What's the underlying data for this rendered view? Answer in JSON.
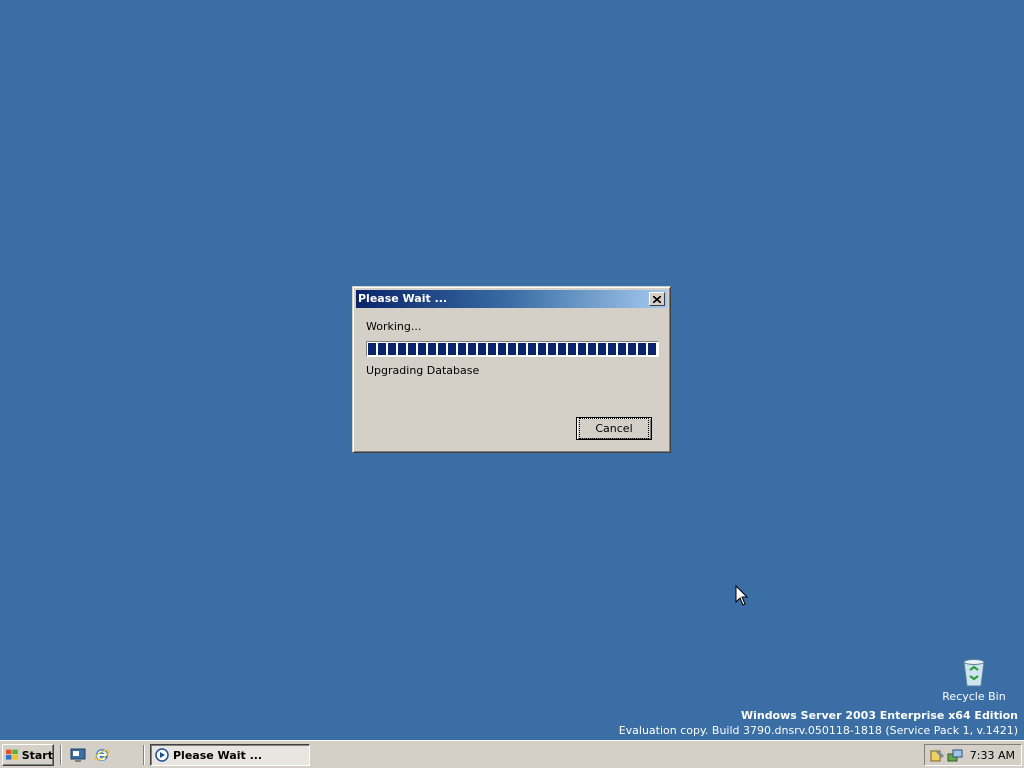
{
  "dialog": {
    "title": "Please Wait ...",
    "message": "Working...",
    "status": "Upgrading Database",
    "progress_percent": 100,
    "cancel_label": "Cancel"
  },
  "desktop": {
    "recycle_bin_label": "Recycle Bin",
    "edition": "Windows Server 2003 Enterprise x64 Edition",
    "build": "Evaluation copy. Build 3790.dnsrv.050118-1818 (Service Pack 1, v.1421)",
    "background_color": "#3a6ea5"
  },
  "taskbar": {
    "start_label": "Start",
    "quick_launch": [
      "show-desktop-icon",
      "internet-explorer-icon"
    ],
    "task_button_label": "Please Wait ...",
    "clock": "7:33 AM"
  }
}
